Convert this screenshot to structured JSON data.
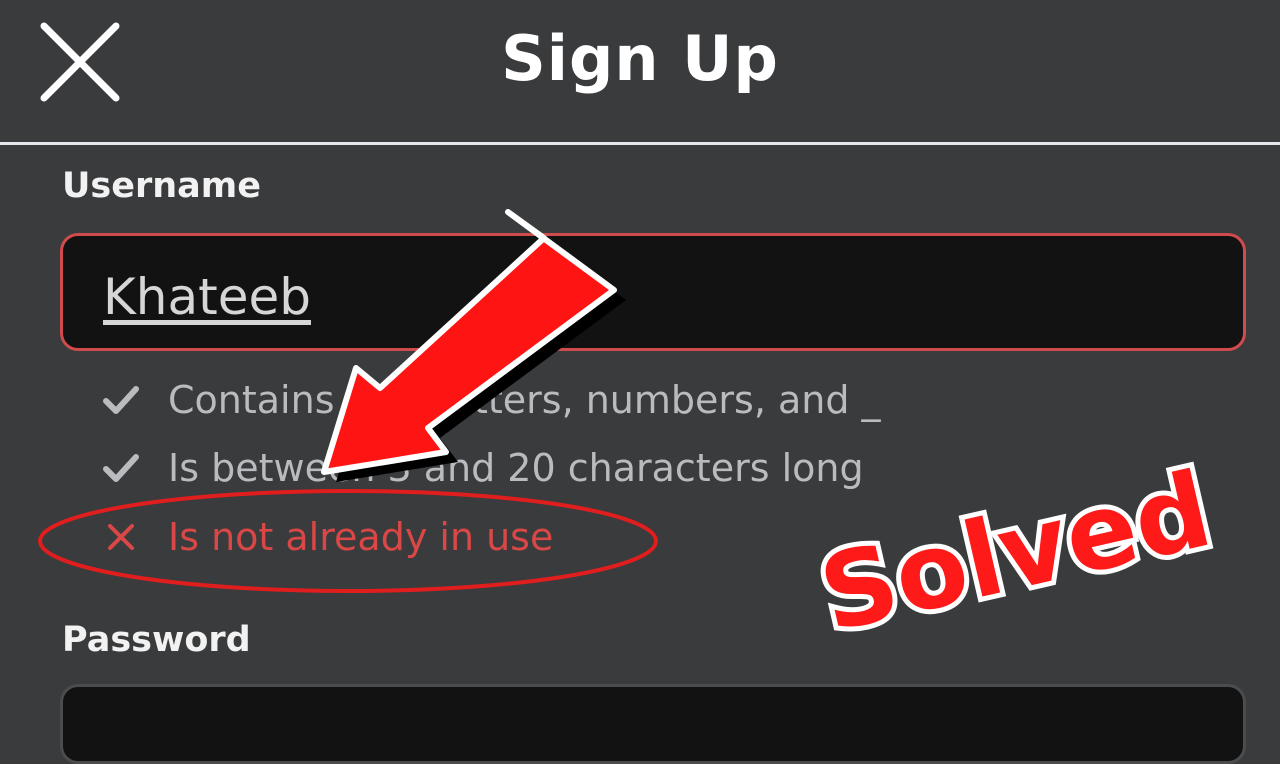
{
  "header": {
    "title": "Sign Up",
    "close_icon": "close-icon"
  },
  "username": {
    "label": "Username",
    "value": "Khateeb",
    "rules": [
      {
        "text": "Contains only letters, numbers, and _",
        "status": "pass",
        "icon": "check-icon"
      },
      {
        "text": "Is between 3 and 20 characters long",
        "status": "pass",
        "icon": "check-icon"
      },
      {
        "text": "Is not already in use",
        "status": "fail",
        "icon": "x-icon"
      }
    ]
  },
  "password": {
    "label": "Password"
  },
  "annotation": {
    "stamp": "Solved",
    "arrow_icon": "red-arrow-icon",
    "highlight": "red-ellipse"
  },
  "colors": {
    "background": "#393b3d",
    "input_background": "#121212",
    "error": "#d94747",
    "annotation_red": "#ff1a1a"
  }
}
